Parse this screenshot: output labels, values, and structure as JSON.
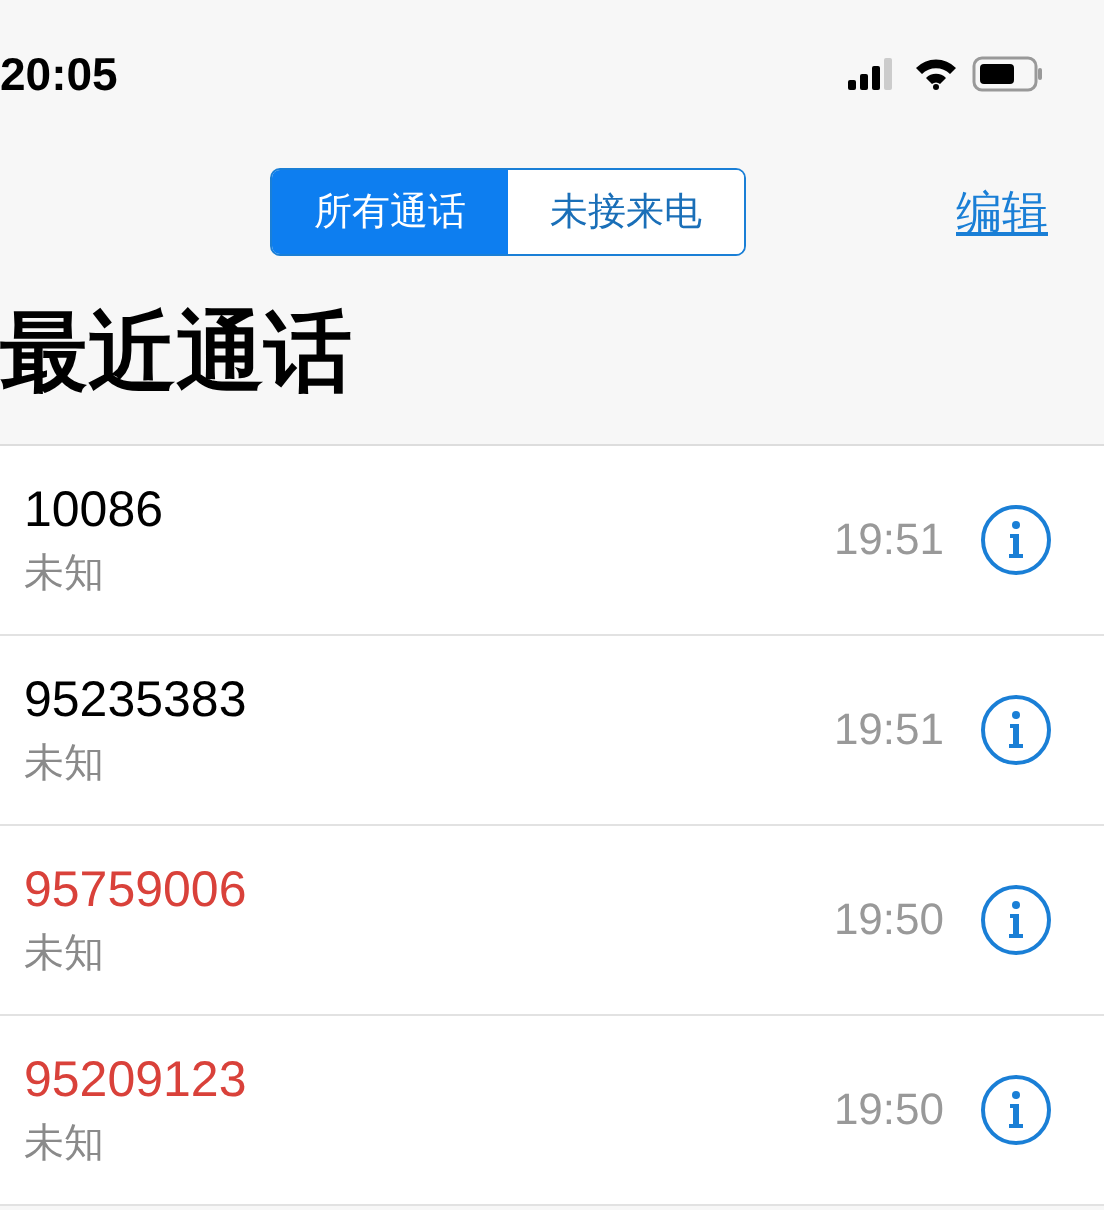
{
  "status_bar": {
    "time": "20:05"
  },
  "segments": [
    {
      "label": "所有通话",
      "selected": true
    },
    {
      "label": "未接来电",
      "selected": false
    }
  ],
  "edit_button": "编辑",
  "title": "最近通话",
  "calls": [
    {
      "number": "10086",
      "label": "未知",
      "time": "19:51",
      "missed": false
    },
    {
      "number": "95235383",
      "label": "未知",
      "time": "19:51",
      "missed": false
    },
    {
      "number": "95759006",
      "label": "未知",
      "time": "19:50",
      "missed": true
    },
    {
      "number": "95209123",
      "label": "未知",
      "time": "19:50",
      "missed": true
    }
  ]
}
